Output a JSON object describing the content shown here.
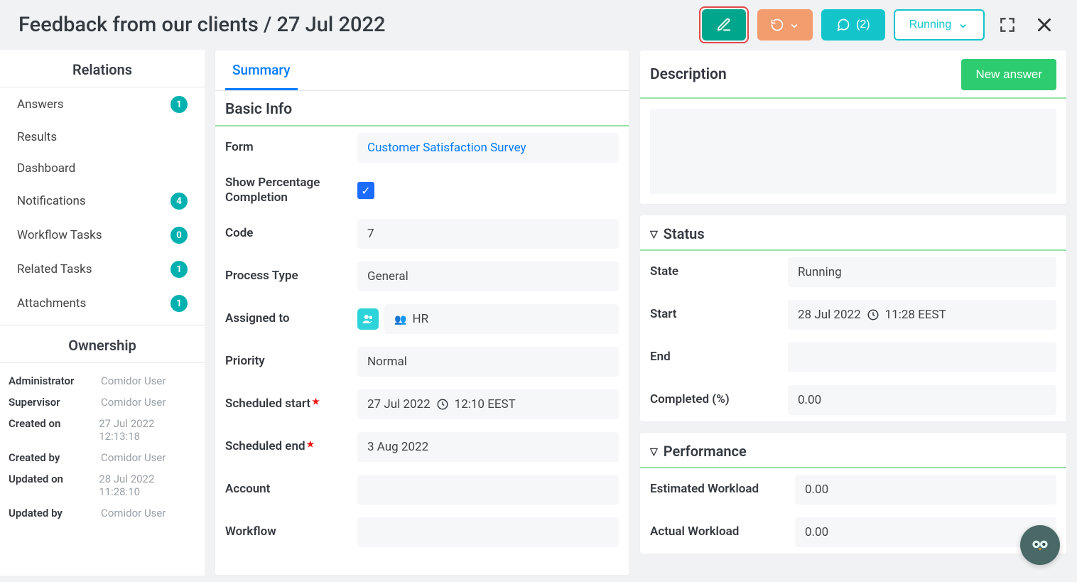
{
  "header": {
    "title": "Feedback from our clients / 27 Jul 2022",
    "comments_label": "(2)",
    "running_label": "Running"
  },
  "sidebar": {
    "relations_title": "Relations",
    "items": [
      {
        "label": "Answers",
        "count": "1"
      },
      {
        "label": "Results",
        "count": null
      },
      {
        "label": "Dashboard",
        "count": null
      },
      {
        "label": "Notifications",
        "count": "4"
      },
      {
        "label": "Workflow Tasks",
        "count": "0"
      },
      {
        "label": "Related Tasks",
        "count": "1"
      },
      {
        "label": "Attachments",
        "count": "1"
      }
    ],
    "ownership_title": "Ownership",
    "ownership": [
      {
        "k": "Administrator",
        "v": "Comidor User"
      },
      {
        "k": "Supervisor",
        "v": "Comidor User"
      },
      {
        "k": "Created on",
        "v": "27 Jul 2022 12:13:18"
      },
      {
        "k": "Created by",
        "v": "Comidor User"
      },
      {
        "k": "Updated on",
        "v": "28 Jul 2022 11:28:10"
      },
      {
        "k": "Updated by",
        "v": "Comidor User"
      }
    ]
  },
  "tabs": {
    "summary": "Summary"
  },
  "basic_info": {
    "title": "Basic Info",
    "form_label": "Form",
    "form_value": "Customer Satisfaction Survey",
    "show_pct_label": "Show Percentage Completion",
    "code_label": "Code",
    "code_value": "7",
    "ptype_label": "Process Type",
    "ptype_value": "General",
    "assigned_label": "Assigned to",
    "assigned_value": "HR",
    "priority_label": "Priority",
    "priority_value": "Normal",
    "sched_start_label": "Scheduled start",
    "sched_start_date": "27 Jul 2022",
    "sched_start_time": "12:10 EEST",
    "sched_end_label": "Scheduled end",
    "sched_end_value": "3 Aug 2022",
    "account_label": "Account",
    "account_value": "",
    "workflow_label": "Workflow",
    "workflow_value": ""
  },
  "description": {
    "title": "Description",
    "new_answer": "New answer"
  },
  "status": {
    "title": "Status",
    "state_label": "State",
    "state_value": "Running",
    "start_label": "Start",
    "start_date": "28 Jul 2022",
    "start_time": "11:28 EEST",
    "end_label": "End",
    "end_value": "",
    "completed_label": "Completed (%)",
    "completed_value": "0.00"
  },
  "performance": {
    "title": "Performance",
    "est_label": "Estimated Workload",
    "est_value": "0.00",
    "act_label": "Actual Workload",
    "act_value": "0.00"
  }
}
